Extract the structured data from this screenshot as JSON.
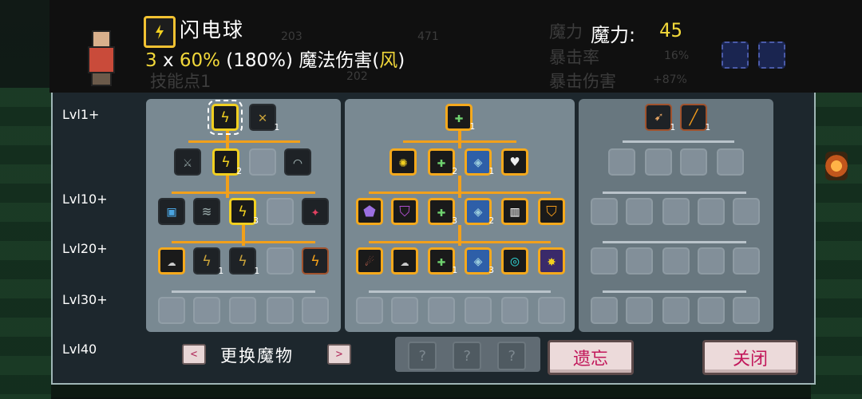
{
  "header": {
    "skill_name": "闪电球",
    "desc_count": "3",
    "desc_x": " x ",
    "desc_percent": "60%",
    "desc_total": " (180%) 魔法伤害(",
    "desc_element": "风",
    "desc_close": ")",
    "mana_label": "魔力:",
    "mana_value": "45",
    "ghost_stat_1": "203",
    "ghost_stat_2": "471",
    "ghost_stat_3": "202",
    "ghost_skill_points": "技能点1",
    "ghost_crit_rate": "暴击率",
    "ghost_crit_damage": "暴击伤害",
    "ghost_crit_rate_val": "16%",
    "ghost_crit_damage_val": "+87%",
    "ghost_mana": "魔力"
  },
  "levels": [
    "Lvl1+",
    "Lvl10+",
    "Lvl20+",
    "Lvl30+",
    "Lvl40"
  ],
  "nodes": {
    "col1_row1_a_level": "",
    "col1_row1_b_level": "1",
    "col1_row1b_center_level": "2",
    "col1_row2_center_level": "3",
    "col1_row3_b_level": "1",
    "col1_row3_c_level": "1",
    "col2_row1_level": "1",
    "col2_row1b_b_level": "2",
    "col2_row1b_c_level": "1",
    "col2_row2_c_level": "3",
    "col2_row2_d_level": "2",
    "col2_row3_c_level": "1",
    "col2_row3_d_level": "3",
    "col3_row1_a_level": "1",
    "col3_row1_b_level": "1"
  },
  "controls": {
    "prev_arrow": "<",
    "next_arrow": ">",
    "swap_label": "更换魔物",
    "slot_1": "?",
    "slot_2": "?",
    "slot_3": "?",
    "forget_button": "遗忘",
    "close_button": "关闭"
  },
  "colors": {
    "accent_orange": "#f5a91c",
    "accent_yellow": "#f2d83a",
    "button_text": "#c2185b"
  }
}
